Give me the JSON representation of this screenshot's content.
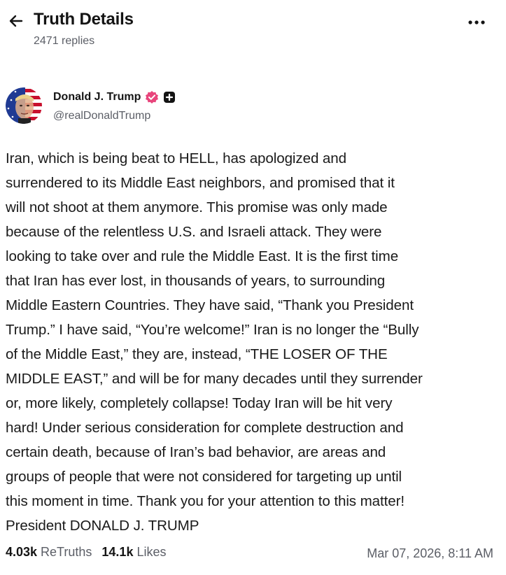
{
  "header": {
    "title": "Truth Details",
    "replies": "2471 replies",
    "back_icon": "arrow-left-icon",
    "more_icon": "ellipsis-icon"
  },
  "author": {
    "name": "Donald J. Trump",
    "handle": "@realDonaldTrump",
    "verified_color": "#e8457c",
    "avatar": "profile-avatar"
  },
  "post": {
    "text": "Iran, which is being beat to HELL, has apologized and\nsurrendered to its Middle East neighbors, and promised that it\nwill not shoot at them anymore. This promise was only made\nbecause of the relentless U.S. and Israeli attack. They were\nlooking to take over and rule the Middle East. It is the first time\nthat Iran has ever lost, in thousands of years, to surrounding\nMiddle Eastern Countries. They have said, “Thank you President\nTrump.” I have said, “You’re welcome!” Iran is no longer the “Bully\nof the Middle East,” they are, instead, “THE LOSER OF THE\nMIDDLE EAST,” and will be for many decades until they surrender\nor, more likely, completely collapse! Today Iran will be hit very\nhard! Under serious consideration for complete destruction and\ncertain death, because of Iran’s bad behavior, are areas and\ngroups of people that were not considered for targeting up until\nthis moment in time. Thank you for your attention to this matter!\nPresident DONALD J. TRUMP"
  },
  "stats": {
    "retruths_count": "4.03k",
    "retruths_label": "ReTruths",
    "likes_count": "14.1k",
    "likes_label": "Likes",
    "timestamp": "Mar 07, 2026, 8:11 AM"
  }
}
